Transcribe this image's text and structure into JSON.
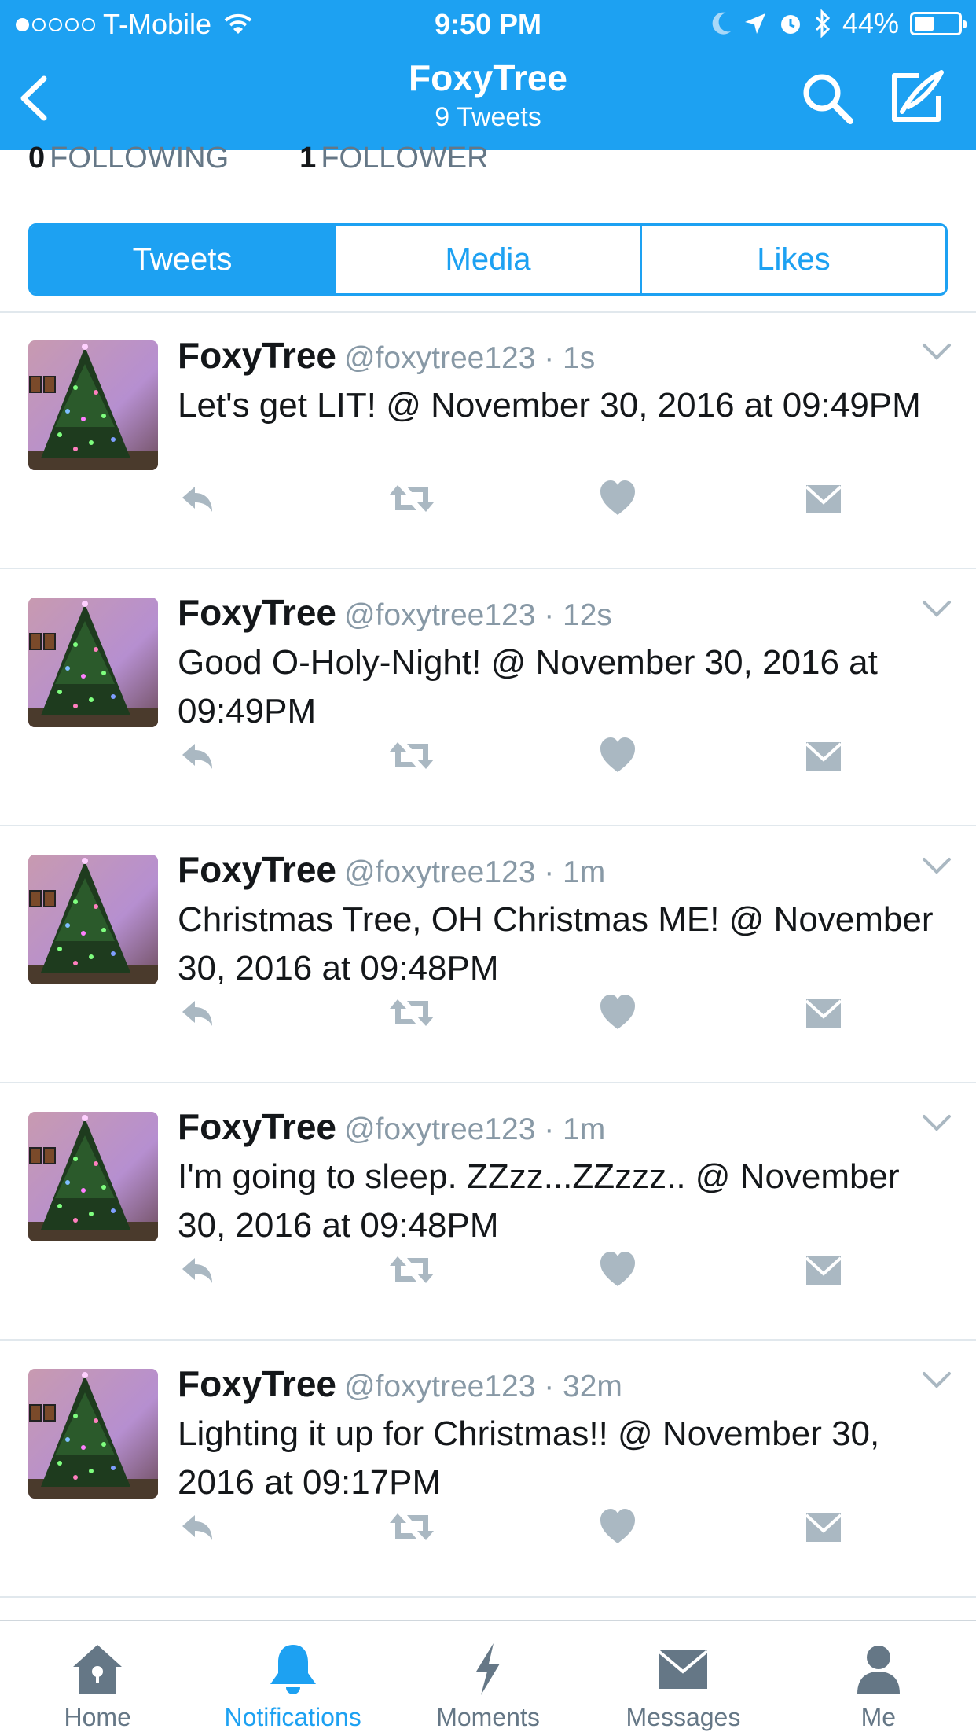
{
  "status_bar": {
    "carrier": "T-Mobile",
    "time": "9:50 PM",
    "battery": "44%",
    "battery_level": 0.44
  },
  "nav": {
    "title": "FoxyTree",
    "subtitle": "9 Tweets",
    "back_icon": "chevron-left-icon",
    "search_icon": "search-icon",
    "compose_icon": "compose-icon"
  },
  "profile": {
    "following_count": "0",
    "following_label": "FOLLOWING",
    "follower_count": "1",
    "follower_label": "FOLLOWER"
  },
  "segments": [
    {
      "label": "Tweets",
      "active": true
    },
    {
      "label": "Media",
      "active": false
    },
    {
      "label": "Likes",
      "active": false
    }
  ],
  "tweets": [
    {
      "name": "FoxyTree",
      "meta": "@foxytree123 · 1s",
      "text": "Let's get LIT! @ November 30, 2016 at 09:49PM"
    },
    {
      "name": "FoxyTree",
      "meta": "@foxytree123 · 12s",
      "text": "Good O-Holy-Night! @ November 30, 2016 at 09:49PM"
    },
    {
      "name": "FoxyTree",
      "meta": "@foxytree123 · 1m",
      "text": "Christmas Tree, OH Christmas ME! @ November 30, 2016 at 09:48PM"
    },
    {
      "name": "FoxyTree",
      "meta": "@foxytree123 · 1m",
      "text": "I'm going to sleep. ZZzz...ZZzzz.. @ November 30, 2016 at 09:48PM"
    },
    {
      "name": "FoxyTree",
      "meta": "@foxytree123 · 32m",
      "text": "Lighting it up for Christmas!! @ November 30, 2016 at 09:17PM"
    }
  ],
  "tabbar": [
    {
      "label": "Home",
      "icon": "home-icon",
      "active": false
    },
    {
      "label": "Notifications",
      "icon": "bell-icon",
      "active": true
    },
    {
      "label": "Moments",
      "icon": "lightning-icon",
      "active": false
    },
    {
      "label": "Messages",
      "icon": "envelope-icon",
      "active": false
    },
    {
      "label": "Me",
      "icon": "person-icon",
      "active": false
    }
  ],
  "colors": {
    "brand": "#1da1f2",
    "icon_gray": "#aab8c2",
    "text_gray": "#657786"
  }
}
